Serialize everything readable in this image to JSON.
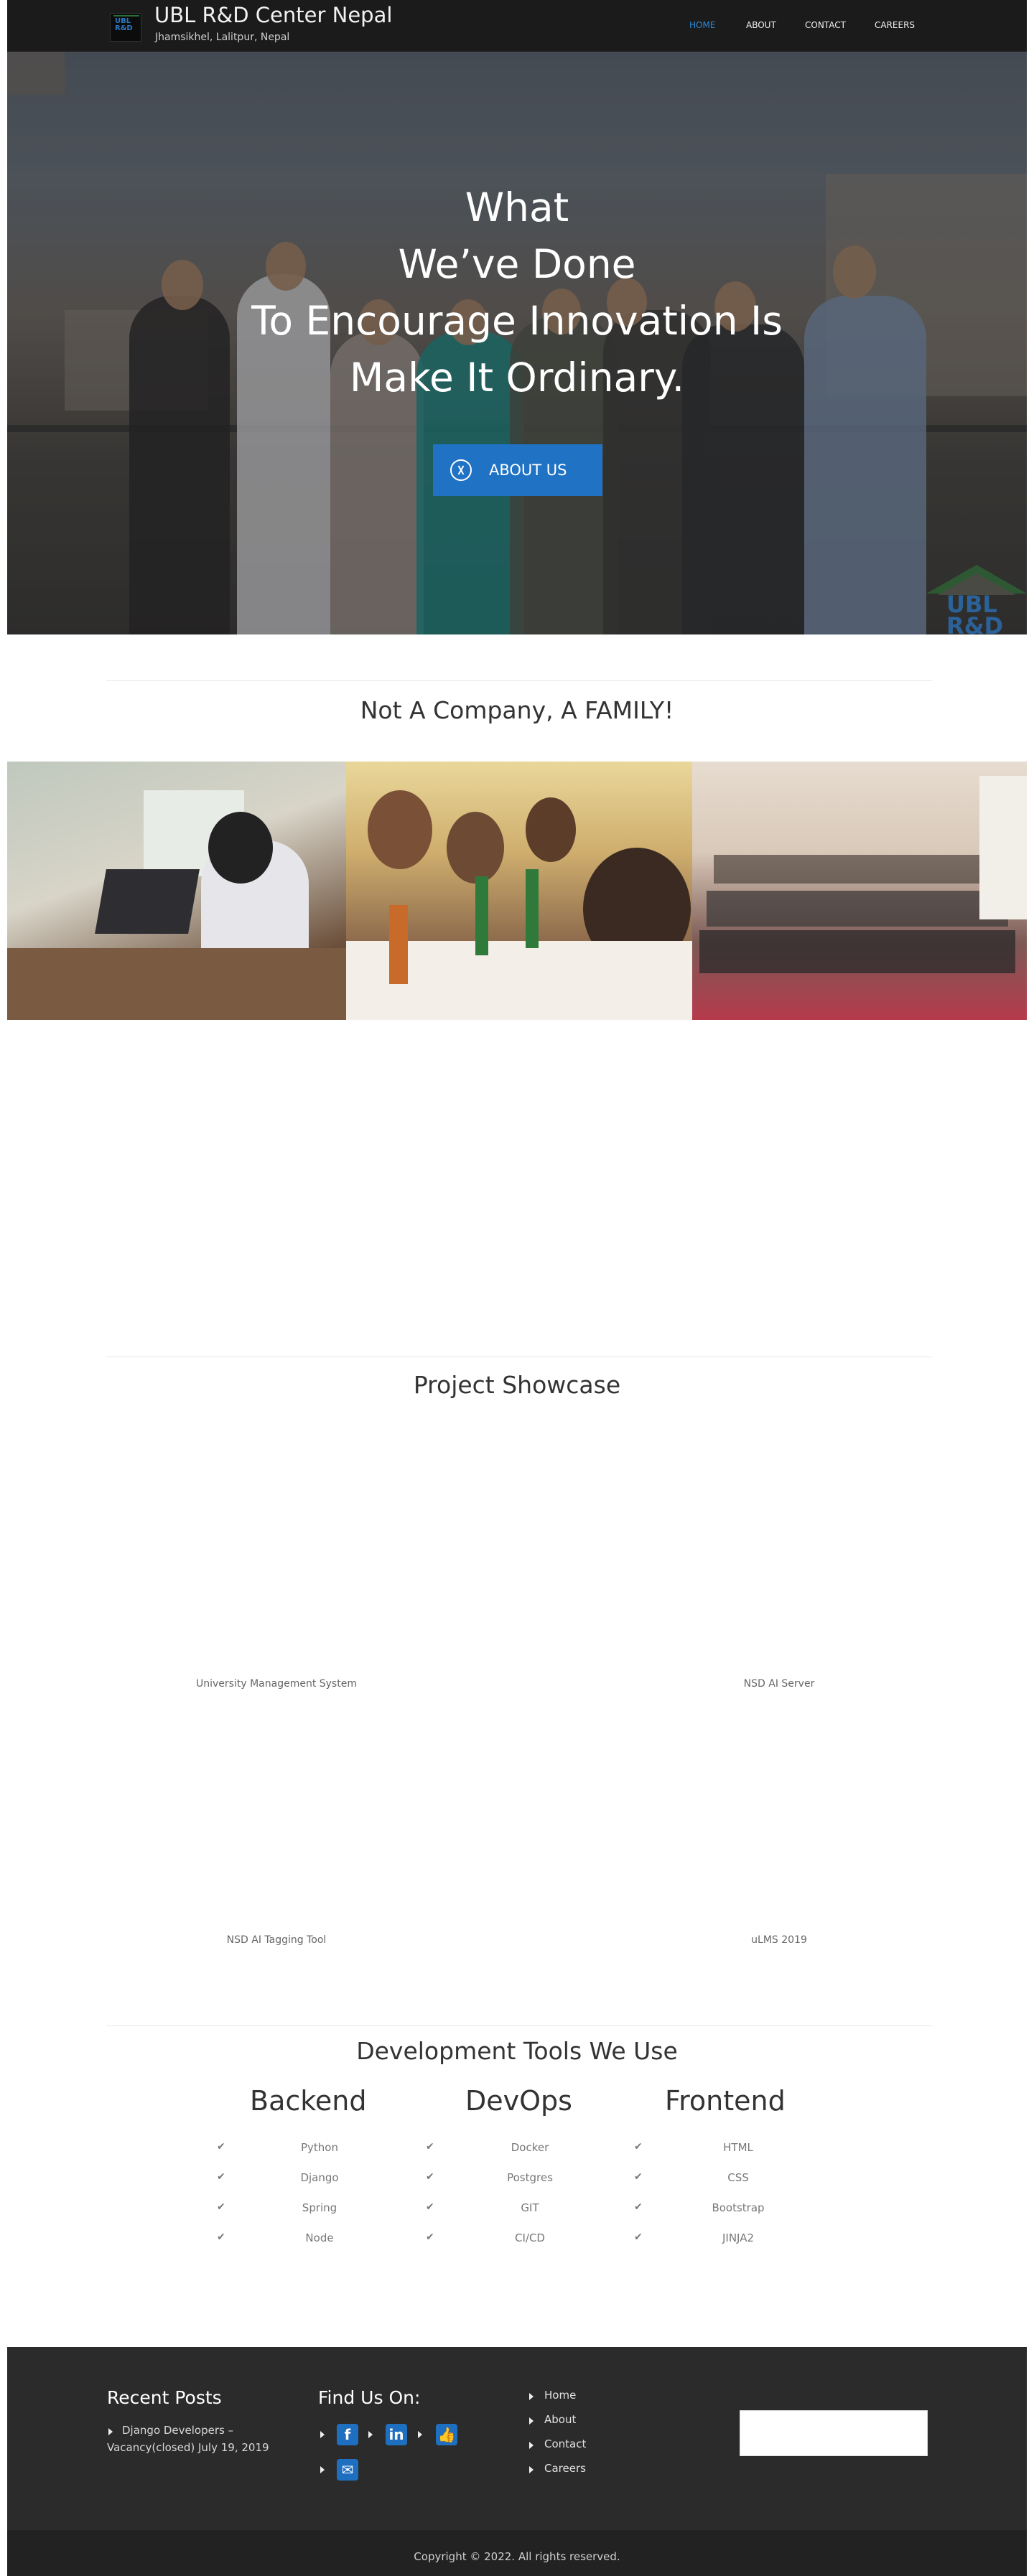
{
  "header": {
    "title": "UBL R&D Center Nepal",
    "subtitle": "Jhamsikhel, Lalitpur, Nepal",
    "logo_text": "UBL R&D",
    "nav": [
      {
        "label": "HOME",
        "active": true
      },
      {
        "label": "ABOUT",
        "active": false
      },
      {
        "label": "CONTACT",
        "active": false
      },
      {
        "label": "CAREERS",
        "active": false
      }
    ]
  },
  "hero": {
    "lines": [
      "What",
      "We’ve Done",
      "To Encourage Innovation Is",
      "Make It Ordinary."
    ],
    "button_label": "ABOUT US",
    "button_icon": "dribbble-icon",
    "corner_logo_text": "UBL R&D"
  },
  "family": {
    "title": "Not A Company, A FAMILY!",
    "photos": [
      "office-work-photo",
      "team-dinner-photo",
      "team-seminar-photo"
    ]
  },
  "showcase": {
    "title": "Project Showcase",
    "projects": [
      "University Management System",
      "NSD AI Server",
      "NSD AI Tagging Tool",
      "uLMS 2019"
    ]
  },
  "tools": {
    "title": "Development Tools We Use",
    "columns": [
      {
        "heading": "Backend",
        "items": [
          "Python",
          "Django",
          "Spring",
          "Node"
        ]
      },
      {
        "heading": "DevOps",
        "items": [
          "Docker",
          "Postgres",
          "GIT",
          "CI/CD"
        ]
      },
      {
        "heading": "Frontend",
        "items": [
          "HTML",
          "CSS",
          "Bootstrap",
          "JINJA2"
        ]
      }
    ],
    "check_glyph": "✔"
  },
  "footer": {
    "recent_posts_title": "Recent Posts",
    "recent_post_line1": "Django Developers –",
    "recent_post_line2": "Vacancy(closed) July 19, 2019",
    "find_us_title": "Find Us On:",
    "social": [
      "facebook-icon",
      "linkedin-icon",
      "like-icon",
      "email-icon"
    ],
    "links": [
      "Home",
      "About",
      "Contact",
      "Careers"
    ],
    "copyright": "Copyright © 2022. All rights reserved."
  },
  "colors": {
    "accent": "#1f72c4",
    "nav_active": "#2b8ad8",
    "header_bg": "#1b1b1b",
    "footer_bg": "#2b2b2b"
  }
}
